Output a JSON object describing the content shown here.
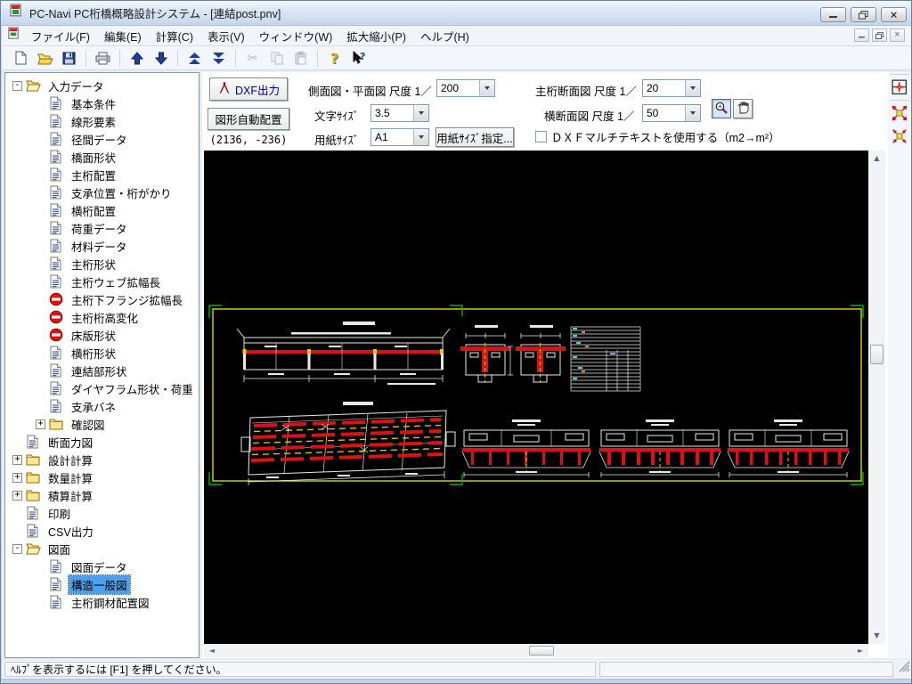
{
  "window": {
    "title": "PC-Navi  PC桁橋概略設計システム - [連結post.pnv]"
  },
  "menu": {
    "items": [
      "ファイル(F)",
      "編集(E)",
      "計算(C)",
      "表示(V)",
      "ウィンドウ(W)",
      "拡大縮小(P)",
      "ヘルプ(H)"
    ]
  },
  "toolbar_icons": [
    "new-file-icon",
    "open-file-icon",
    "save-icon",
    "print-icon",
    "arrow-up-icon",
    "arrow-down-icon",
    "double-arrow-up-icon",
    "double-arrow-down-icon",
    "cut-icon",
    "copy-icon",
    "paste-icon",
    "help-icon",
    "context-help-icon"
  ],
  "panel": {
    "dxf_export": "DXF出力",
    "auto_layout": "図形自動配置",
    "coords": "(2136, -236)",
    "side_plan_label": "側面図・平面図 尺度 1／",
    "side_plan_scale": "200",
    "char_size_label": "文字ｻｲｽﾞ",
    "char_size": "3.5",
    "paper_size_label": "用紙ｻｲｽﾞ",
    "paper_size": "A1",
    "paper_size_spec": "用紙ｻｲｽﾞ指定...",
    "girder_section_label": "主桁断面図 尺度 1／",
    "girder_section_scale": "20",
    "cross_section_label": "横断面図 尺度 1／",
    "cross_section_scale": "50",
    "multitext_label": "ＤＸＦマルチテキストを使用する（m2→m²）",
    "multitext_checked": false
  },
  "drawing": {
    "accent_colors": {
      "paper_border": "#d8d800",
      "register_marks": "#00b400",
      "lines": "#e8e8e8",
      "girders": "#dd1111"
    }
  },
  "tree": {
    "items": [
      {
        "label": "入力データ",
        "level": 0,
        "icon": "folder-open",
        "expander": "minus",
        "selected": false
      },
      {
        "label": "基本条件",
        "level": 1,
        "icon": "doc",
        "expander": null,
        "selected": false
      },
      {
        "label": "線形要素",
        "level": 1,
        "icon": "doc",
        "expander": null,
        "selected": false
      },
      {
        "label": "径間データ",
        "level": 1,
        "icon": "doc",
        "expander": null,
        "selected": false
      },
      {
        "label": "橋面形状",
        "level": 1,
        "icon": "doc",
        "expander": null,
        "selected": false
      },
      {
        "label": "主桁配置",
        "level": 1,
        "icon": "doc",
        "expander": null,
        "selected": false
      },
      {
        "label": "支承位置・桁がかり",
        "level": 1,
        "icon": "doc",
        "expander": null,
        "selected": false
      },
      {
        "label": "横桁配置",
        "level": 1,
        "icon": "doc",
        "expander": null,
        "selected": false
      },
      {
        "label": "荷重データ",
        "level": 1,
        "icon": "doc",
        "expander": null,
        "selected": false
      },
      {
        "label": "材料データ",
        "level": 1,
        "icon": "doc",
        "expander": null,
        "selected": false
      },
      {
        "label": "主桁形状",
        "level": 1,
        "icon": "doc",
        "expander": null,
        "selected": false
      },
      {
        "label": "主桁ウェブ拡幅長",
        "level": 1,
        "icon": "doc",
        "expander": null,
        "selected": false
      },
      {
        "label": "主桁下フランジ拡幅長",
        "level": 1,
        "icon": "noentry",
        "expander": null,
        "selected": false
      },
      {
        "label": "主桁桁高変化",
        "level": 1,
        "icon": "noentry",
        "expander": null,
        "selected": false
      },
      {
        "label": "床版形状",
        "level": 1,
        "icon": "noentry",
        "expander": null,
        "selected": false
      },
      {
        "label": "横桁形状",
        "level": 1,
        "icon": "doc",
        "expander": null,
        "selected": false
      },
      {
        "label": "連結部形状",
        "level": 1,
        "icon": "doc",
        "expander": null,
        "selected": false
      },
      {
        "label": "ダイヤフラム形状・荷重",
        "level": 1,
        "icon": "doc",
        "expander": null,
        "selected": false
      },
      {
        "label": "支承バネ",
        "level": 1,
        "icon": "doc",
        "expander": null,
        "selected": false
      },
      {
        "label": "確認図",
        "level": 1,
        "icon": "folder-closed",
        "expander": "plus",
        "selected": false
      },
      {
        "label": "断面力図",
        "level": 0,
        "icon": "doc",
        "expander": null,
        "selected": false
      },
      {
        "label": "設計計算",
        "level": 0,
        "icon": "folder-closed",
        "expander": "plus",
        "selected": false
      },
      {
        "label": "数量計算",
        "level": 0,
        "icon": "folder-closed",
        "expander": "plus",
        "selected": false
      },
      {
        "label": "積算計算",
        "level": 0,
        "icon": "folder-closed",
        "expander": "plus",
        "selected": false
      },
      {
        "label": "印刷",
        "level": 0,
        "icon": "doc",
        "expander": null,
        "selected": false
      },
      {
        "label": "CSV出力",
        "level": 0,
        "icon": "doc",
        "expander": null,
        "selected": false
      },
      {
        "label": "図面",
        "level": 0,
        "icon": "folder-open",
        "expander": "minus",
        "selected": false
      },
      {
        "label": "図面データ",
        "level": 1,
        "icon": "doc",
        "expander": null,
        "selected": false
      },
      {
        "label": "構造一般図",
        "level": 1,
        "icon": "doc",
        "expander": null,
        "selected": true
      },
      {
        "label": "主桁鋼材配置図",
        "level": 1,
        "icon": "doc",
        "expander": null,
        "selected": false
      }
    ]
  },
  "statusbar": {
    "message": "ﾍﾙﾌﾟを表示するには [F1] を押してください。"
  }
}
